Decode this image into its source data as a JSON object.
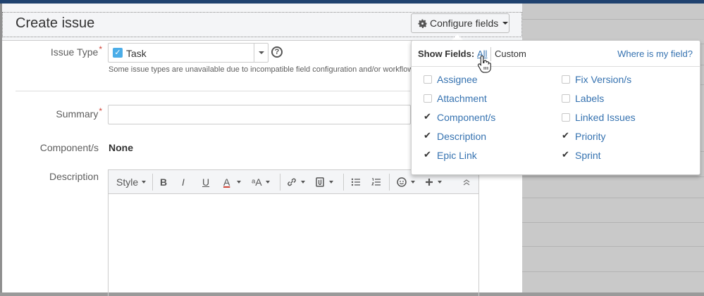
{
  "dialog": {
    "title": "Create issue",
    "configure_fields_label": "Configure fields"
  },
  "form": {
    "issue_type_label": "Issue Type",
    "issue_type_value": "Task",
    "issue_type_note": "Some issue types are unavailable due to incompatible field configuration and/or workflow",
    "summary_label": "Summary",
    "summary_value": "",
    "components_label": "Component/s",
    "components_value": "None",
    "description_label": "Description",
    "required_marker": "*"
  },
  "editor_toolbar": {
    "style_label": "Style",
    "bold": "B",
    "italic": "I",
    "underline": "U",
    "text_color": "A",
    "text_size": "ᵃA"
  },
  "popup": {
    "show_fields_label": "Show Fields:",
    "tab_all": "All",
    "tab_custom": "Custom",
    "where_link": "Where is my field?",
    "fields": [
      {
        "label": "Assignee",
        "checked": false
      },
      {
        "label": "Attachment",
        "checked": false
      },
      {
        "label": "Component/s",
        "checked": true
      },
      {
        "label": "Description",
        "checked": true
      },
      {
        "label": "Epic Link",
        "checked": true
      },
      {
        "label": "Fix Version/s",
        "checked": false
      },
      {
        "label": "Labels",
        "checked": false
      },
      {
        "label": "Linked Issues",
        "checked": false
      },
      {
        "label": "Priority",
        "checked": true
      },
      {
        "label": "Sprint",
        "checked": true
      }
    ]
  },
  "colors": {
    "link": "#3572b0",
    "required": "#d04437",
    "header_bar": "#20426f",
    "task_icon": "#4bade8"
  }
}
